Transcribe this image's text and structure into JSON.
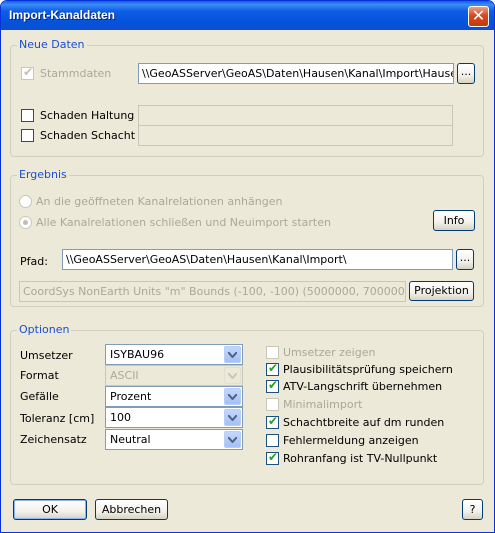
{
  "window": {
    "title": "Import-Kanaldaten",
    "close_glyph": "✕"
  },
  "neue_daten": {
    "title": "Neue Daten",
    "stammdaten": {
      "label": "Stammdaten",
      "checked": true,
      "enabled": false,
      "path": "\\\\GeoASServer\\GeoAS\\Daten\\Hausen\\Kanal\\Import\\Hausen.K",
      "browse": "..."
    },
    "schaden_haltung": {
      "label": "Schaden Haltung",
      "checked": false,
      "path": ""
    },
    "schaden_schacht": {
      "label": "Schaden Schacht",
      "checked": false,
      "path": ""
    }
  },
  "ergebnis": {
    "title": "Ergebnis",
    "radio_append": "An die geöffneten Kanalrelationen anhängen",
    "radio_new": "Alle Kanalrelationen schließen und Neuimport starten",
    "info_button": "Info",
    "pfad_label": "Pfad:",
    "pfad_value": "\\\\GeoASServer\\GeoAS\\Daten\\Hausen\\Kanal\\Import\\",
    "browse": "...",
    "projection_value": "CoordSys NonEarth Units \"m\" Bounds (-100, -100) (5000000, 7000000)",
    "projection_button": "Projektion"
  },
  "optionen": {
    "title": "Optionen",
    "fields": [
      {
        "label": "Umsetzer",
        "value": "ISYBAU96",
        "enabled": true
      },
      {
        "label": "Format",
        "value": "ASCII",
        "enabled": false
      },
      {
        "label": "Gefälle",
        "value": "Prozent",
        "enabled": true
      },
      {
        "label": "Toleranz [cm]",
        "value": "100",
        "enabled": true
      },
      {
        "label": "Zeichensatz",
        "value": "Neutral",
        "enabled": true
      }
    ],
    "checks": [
      {
        "label": "Umsetzer zeigen",
        "checked": false,
        "enabled": false
      },
      {
        "label": "Plausibilitätsprüfung speichern",
        "checked": true,
        "enabled": true
      },
      {
        "label": "ATV-Langschrift übernehmen",
        "checked": true,
        "enabled": true
      },
      {
        "label": "Minimalimport",
        "checked": false,
        "enabled": false
      },
      {
        "label": "Schachtbreite auf dm runden",
        "checked": true,
        "enabled": true
      },
      {
        "label": "Fehlermeldung anzeigen",
        "checked": false,
        "enabled": true
      },
      {
        "label": "Rohranfang ist TV-Nullpunkt",
        "checked": true,
        "enabled": true
      }
    ]
  },
  "footer": {
    "ok": "OK",
    "cancel": "Abbrechen",
    "help": "?"
  }
}
